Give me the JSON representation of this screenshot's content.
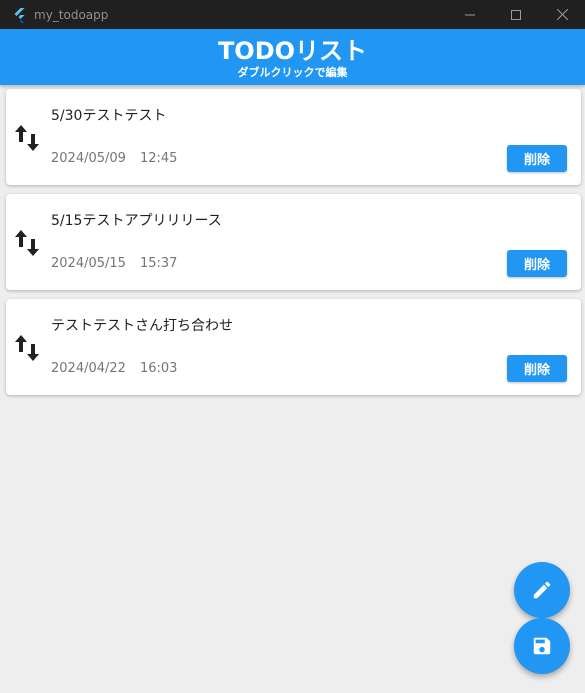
{
  "window": {
    "title": "my_todoapp"
  },
  "appbar": {
    "title": "TODOリスト",
    "subtitle": "ダブルクリックで編集"
  },
  "todos": [
    {
      "title": "5/30テストテスト",
      "date": "2024/05/09",
      "time": "12:45",
      "delete_label": "削除"
    },
    {
      "title": "5/15テストアプリリリース",
      "date": "2024/05/15",
      "time": "15:37",
      "delete_label": "削除"
    },
    {
      "title": "テストテストさん打ち合わせ",
      "date": "2024/04/22",
      "time": "16:03",
      "delete_label": "削除"
    }
  ],
  "fabs": {
    "edit_icon": "pencil-icon",
    "save_icon": "floppy-disk-icon"
  },
  "colors": {
    "accent": "#2196f3",
    "background": "#eeeeee",
    "titlebar": "#202020"
  }
}
